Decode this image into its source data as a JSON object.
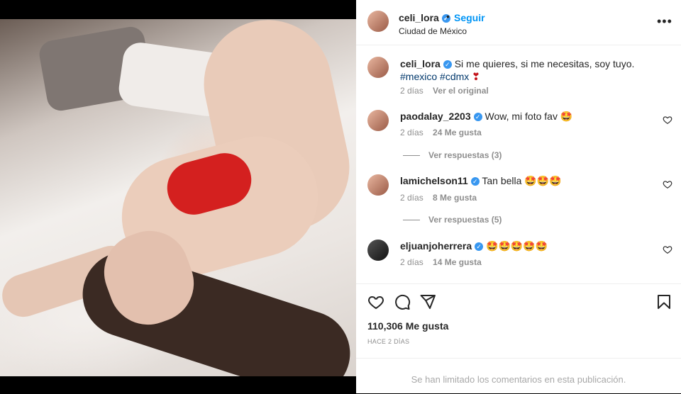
{
  "post": {
    "username": "celi_lora",
    "follow_label": "Seguir",
    "separator": "•",
    "location": "Ciudad de México",
    "more_label": "•••",
    "caption": {
      "username": "celi_lora",
      "text": "Si me quieres, si me necesitas, soy tuyo.",
      "tag1": "#mexico",
      "tag2": "#cdmx",
      "emoji": "❣",
      "time": "2 días",
      "see_original": "Ver el original"
    },
    "comments": [
      {
        "username": "paodalay_2203",
        "text": "Wow, mi foto fav",
        "emoji": "🤩",
        "time": "2 días",
        "likes": "24 Me gusta",
        "replies": "Ver respuestas (3)"
      },
      {
        "username": "lamichelson11",
        "text": "Tan bella",
        "emoji": "🤩🤩🤩",
        "time": "2 días",
        "likes": "8 Me gusta",
        "replies": "Ver respuestas (5)"
      },
      {
        "username": "eljuanjoherrera",
        "text": "",
        "emoji": "🤩🤩🤩🤩🤩",
        "time": "2 días",
        "likes": "14 Me gusta"
      }
    ],
    "like_count": "110,306 Me gusta",
    "posted_ago": "HACE 2 DÍAS",
    "comments_limited": "Se han limitado los comentarios en esta publicación."
  },
  "icons": {
    "like": "heart-icon",
    "comment": "comment-icon",
    "share": "paper-plane-icon",
    "save": "bookmark-icon",
    "verified": "verified-badge-icon"
  },
  "colors": {
    "follow": "#0095f6",
    "verified": "#3897f0",
    "secondary_text": "#8e8e8e",
    "bra_red": "#d4201f"
  }
}
